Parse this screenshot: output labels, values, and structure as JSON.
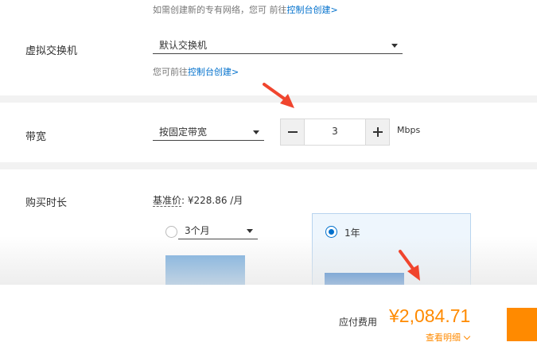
{
  "vswitch_section": {
    "top_hint": "如需创建新的专有网络，您可 前往",
    "top_hint_link": "控制台创建>",
    "label": "虚拟交换机",
    "select_value": "默认交换机",
    "bottom_hint": "您可前往",
    "bottom_hint_link": "控制台创建>"
  },
  "bandwidth_section": {
    "label": "带宽",
    "billing_select_value": "按固定带宽",
    "stepper_value": "3",
    "unit": "Mbps"
  },
  "duration_section": {
    "label": "购买时长",
    "base_price_label": "基准价",
    "base_price_value": ": ¥228.86 /月",
    "option_3m": "3个月",
    "option_1y": "1年",
    "selected_option": "1年"
  },
  "footer": {
    "fee_label": "应付费用",
    "fee_amount": "¥2,084.71",
    "detail_link": "查看明细"
  },
  "colors": {
    "accent_orange": "#ff8a00",
    "link_blue": "#0070cc",
    "annotation_red": "#f0452e"
  },
  "icons": {
    "minus": "minus-icon",
    "plus": "plus-icon",
    "dropdown": "caret-down-icon",
    "detail": "chevron-down-icon",
    "annotation": "red-arrow-annotation"
  }
}
